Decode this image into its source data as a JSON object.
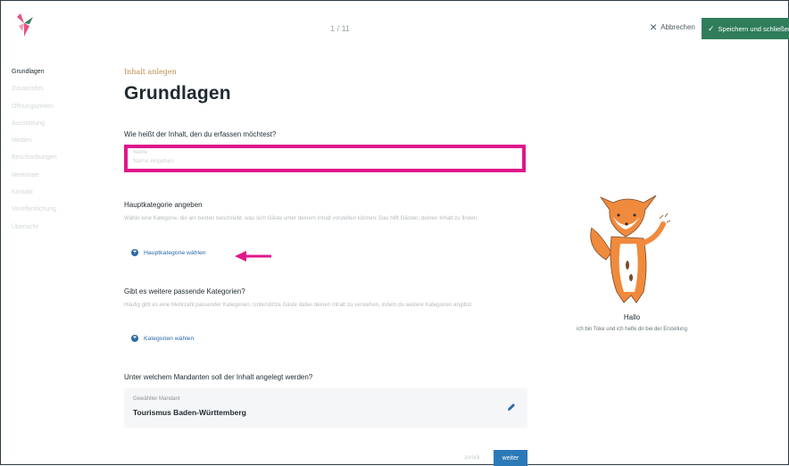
{
  "header": {
    "step": "1 / 11",
    "abort_label": "Abbrechen",
    "save_label": "Speichern und schließen"
  },
  "sidebar": {
    "items": [
      {
        "label": "Grundlagen",
        "active": true
      },
      {
        "label": "Zusatzinfos",
        "active": false
      },
      {
        "label": "Öffnungszeiten",
        "active": false
      },
      {
        "label": "Ausstattung",
        "active": false
      },
      {
        "label": "Medien",
        "active": false
      },
      {
        "label": "Beschreibungen",
        "active": false
      },
      {
        "label": "Merkmale",
        "active": false
      },
      {
        "label": "Kontakt",
        "active": false
      },
      {
        "label": "Veröffentlichung",
        "active": false
      },
      {
        "label": "Übersicht",
        "active": false
      }
    ]
  },
  "main": {
    "eyebrow": "Inhalt anlegen",
    "title": "Grundlagen",
    "name_question": "Wie heißt der Inhalt, den du erfassen möchtest?",
    "name_field_label": "Name",
    "name_field_placeholder": "Name eingeben",
    "main_category_title": "Hauptkategorie angeben",
    "main_category_desc": "Wähle eine Kategorie, die am besten beschreibt, was sich Gäste unter deinem Inhalt vorstellen können. Das hilft Gästen, deinen Inhalt zu finden.",
    "main_category_button": "Hauptkategorie wählen",
    "more_categories_title": "Gibt es weitere passende Kategorien?",
    "more_categories_desc": "Häufig gibt es eine Mehrzahl passender Kategorien. Unterstütze Gäste dabei deinen Inhalt zu verstehen, indem du weitere Kategorien angibst.",
    "more_categories_button": "Kategorien wählen",
    "client_question": "Unter welchem Mandanten soll der Inhalt angelegt werden?",
    "client_label": "Gewählter Mandant",
    "client_value": "Tourismus Baden-Württemberg",
    "back_label": "zurück",
    "next_label": "weiter"
  },
  "helper": {
    "greeting": "Hallo",
    "intro": "ich bin Toke und ich helfe dir bei der Erstellung"
  },
  "colors": {
    "accent_green": "#2f7d5b",
    "highlight_pink": "#e0178a",
    "link_blue": "#2a6aa7",
    "next_blue": "#2c79b8"
  }
}
